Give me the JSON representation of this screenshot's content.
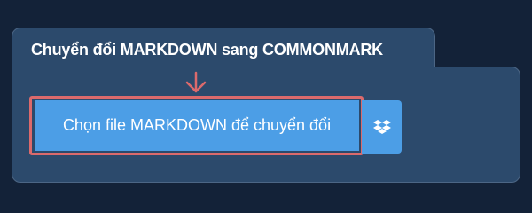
{
  "page": {
    "title": "Chuyển đổi MARKDOWN sang COMMONMARK"
  },
  "upload": {
    "button_label": "Chọn file MARKDOWN để chuyển đổi",
    "dropbox_icon": "dropbox-icon",
    "arrow_icon": "arrow-down-icon"
  },
  "colors": {
    "background": "#132238",
    "panel": "#2c4a6c",
    "panel_border": "#4c6685",
    "button": "#4c9ee6",
    "highlight": "#dc6a6c"
  }
}
